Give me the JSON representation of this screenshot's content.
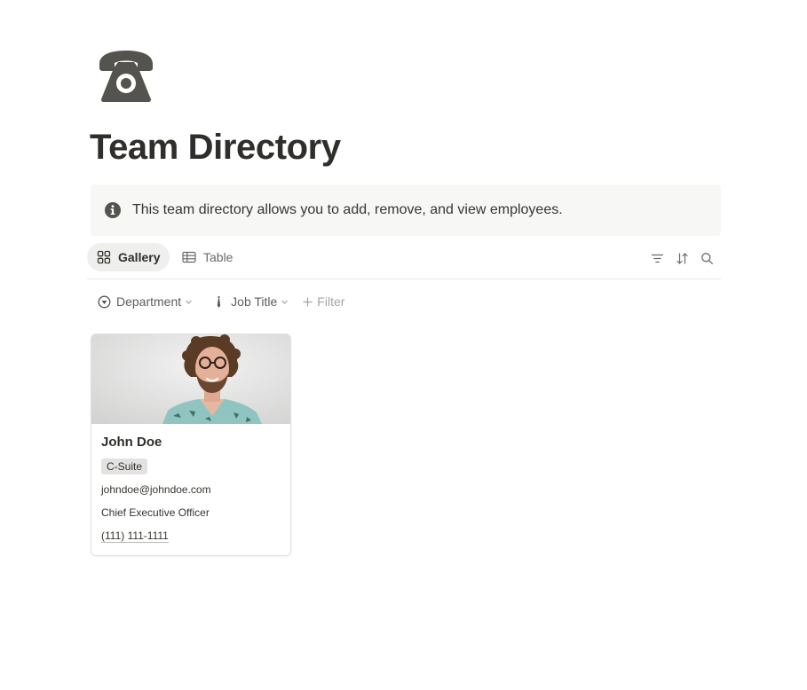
{
  "page": {
    "icon": "telephone-icon",
    "title": "Team Directory"
  },
  "callout": {
    "icon": "info-icon",
    "text": "This team directory allows you to add, remove, and view employees."
  },
  "views": {
    "tabs": [
      {
        "label": "Gallery",
        "icon": "gallery-grid-icon",
        "active": true
      },
      {
        "label": "Table",
        "icon": "table-icon",
        "active": false
      }
    ],
    "tools": [
      "filter-icon",
      "sort-icon",
      "search-icon"
    ]
  },
  "filters": {
    "department": {
      "label": "Department",
      "icon": "department-select-icon"
    },
    "job_title": {
      "label": "Job Title",
      "icon": "tie-icon"
    },
    "add_filter": {
      "label": "Filter",
      "icon": "plus-icon"
    }
  },
  "cards": [
    {
      "name": "John Doe",
      "tag": "C-Suite",
      "email": "johndoe@johndoe.com",
      "job_title": "Chief Executive Officer",
      "phone": "(111) 111-1111"
    }
  ],
  "colors": {
    "text": "#37352f",
    "callout_bg": "#f7f7f5",
    "active_tab_bg": "#efefed",
    "tag_bg": "#e3e2e0",
    "icon": "#55534e"
  }
}
